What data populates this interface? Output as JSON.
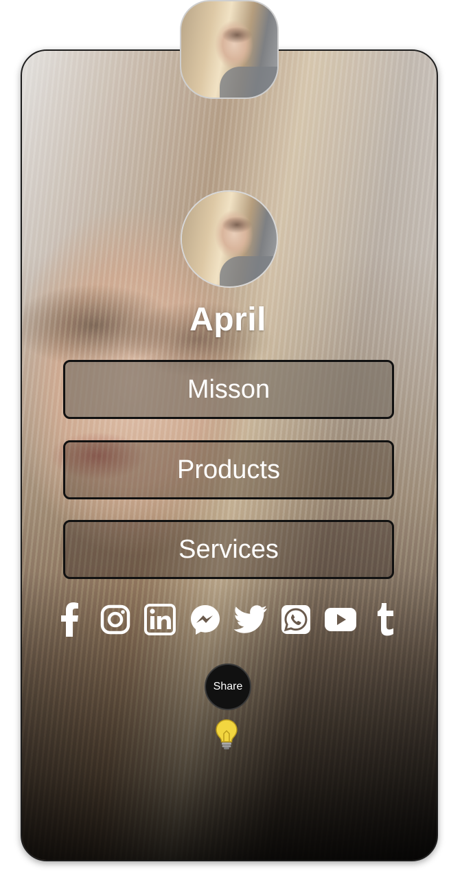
{
  "profile": {
    "name": "April"
  },
  "links": [
    {
      "label": "Misson"
    },
    {
      "label": "Products"
    },
    {
      "label": "Services"
    }
  ],
  "social_icons": [
    "facebook-icon",
    "instagram-icon",
    "linkedin-icon",
    "messenger-icon",
    "twitter-icon",
    "whatsapp-icon",
    "youtube-icon",
    "tumblr-icon"
  ],
  "share": {
    "label": "Share"
  },
  "tip_icon": "lightbulb-icon",
  "colors": {
    "text": "#ffffff",
    "button_border": "#111111",
    "share_bg": "#111111",
    "bulb": "#f2d640"
  }
}
